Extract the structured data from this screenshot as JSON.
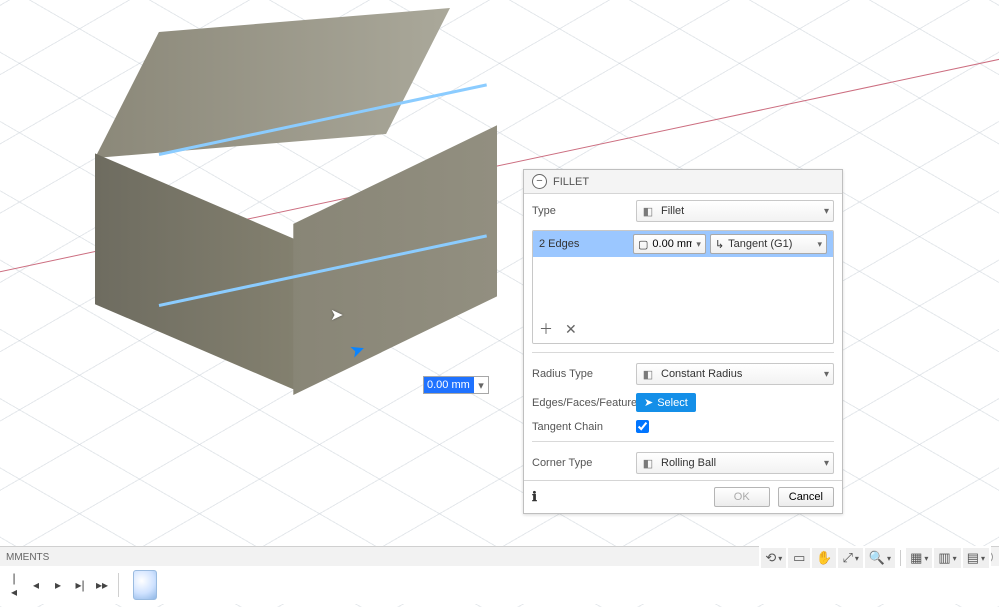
{
  "panel": {
    "title": "FILLET",
    "type_label": "Type",
    "type_value": "Fillet",
    "edges_label": "2 Edges",
    "edges_value": "0.00 mm",
    "continuity": "Tangent (G1)",
    "radius_type_label": "Radius Type",
    "radius_type_value": "Constant Radius",
    "edges_faces_label": "Edges/Faces/Features",
    "select_label": "Select",
    "tangent_chain_label": "Tangent Chain",
    "corner_type_label": "Corner Type",
    "corner_type_value": "Rolling Ball",
    "ok": "OK",
    "cancel": "Cancel"
  },
  "dimension_input": "0.00 mm",
  "comments_label": "MMENTS",
  "icons": {
    "fillet": "▢",
    "cube": "▢",
    "continuity": "↳",
    "pointer": "▲"
  }
}
